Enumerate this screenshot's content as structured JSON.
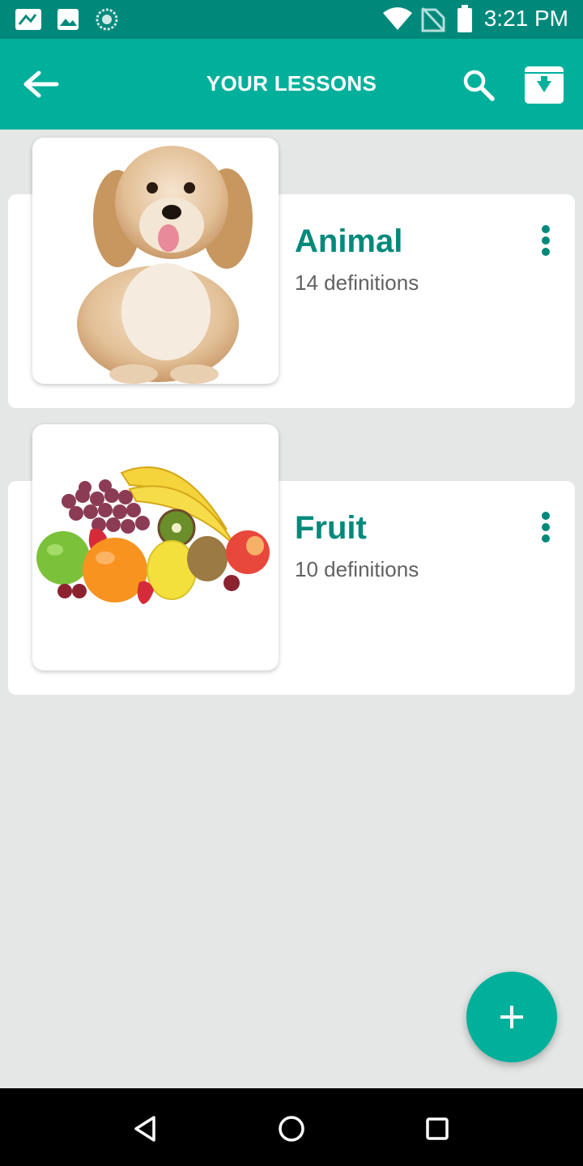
{
  "status_bar": {
    "time": "3:21 PM",
    "left_icons": [
      "mail-icon",
      "image-icon",
      "sync-icon"
    ],
    "right_icons": [
      "wifi-icon",
      "no-signal-icon",
      "battery-icon"
    ]
  },
  "app_bar": {
    "title": "YOUR LESSONS",
    "icons": [
      "back-arrow-icon",
      "search-icon",
      "archive-download-icon"
    ]
  },
  "lessons": [
    {
      "name": "Animal",
      "count": "14 definitions",
      "image": "puppy-photo"
    },
    {
      "name": "Fruit",
      "count": "10 definitions",
      "image": "fruit-pile-photo"
    }
  ],
  "fab": {
    "icon": "plus-icon"
  },
  "nav_bar": {
    "icons": [
      "back-triangle-icon",
      "home-circle-icon",
      "recents-square-icon"
    ]
  },
  "colors": {
    "primary": "#00b09b",
    "primary_dark": "#00897b",
    "background": "#e5e7e6",
    "card": "#ffffff",
    "secondary_text": "#616161"
  }
}
